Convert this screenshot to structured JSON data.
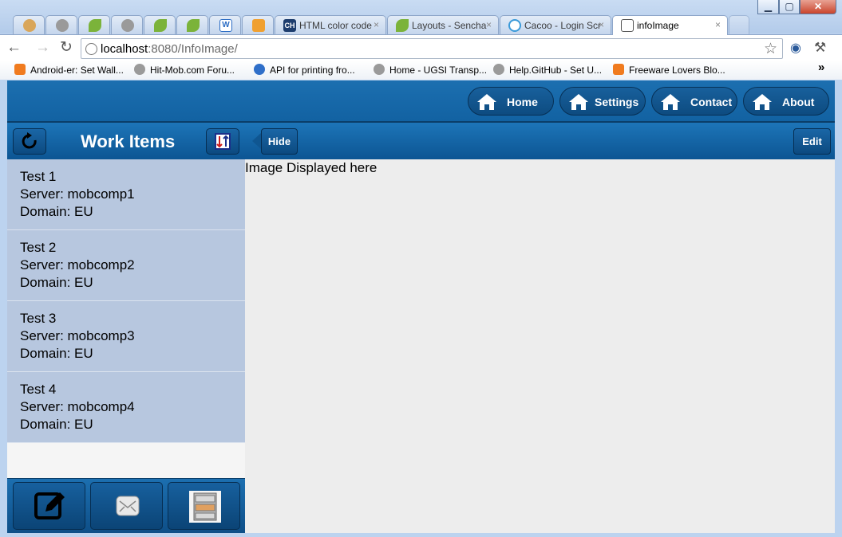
{
  "browser": {
    "tabs": [
      {
        "title": "",
        "icon": "cookie-icon",
        "color": "#d9a65a"
      },
      {
        "title": "",
        "icon": "globe-icon",
        "color": "#8a8a8a"
      },
      {
        "title": "",
        "icon": "sencha-leaf-icon",
        "color": "#7bb33a"
      },
      {
        "title": "",
        "icon": "globe-icon",
        "color": "#8a8a8a"
      },
      {
        "title": "",
        "icon": "sencha-leaf-icon",
        "color": "#7bb33a"
      },
      {
        "title": "",
        "icon": "sencha-leaf-icon",
        "color": "#7bb33a"
      },
      {
        "title": "",
        "icon": "word-doc-icon",
        "color": "#2b6cc4"
      },
      {
        "title": "",
        "icon": "blocks-icon",
        "color": "#f0a030"
      },
      {
        "title": "HTML color code",
        "icon": "ch-icon",
        "color": "#1d3d6e"
      },
      {
        "title": "Layouts - Sencha",
        "icon": "sencha-leaf-icon",
        "color": "#7bb33a"
      },
      {
        "title": "Cacoo - Login Scr",
        "icon": "cacoo-icon",
        "color": "#3a9ad9"
      },
      {
        "title": "infoImage",
        "icon": "image-icon",
        "color": "#b08050"
      }
    ],
    "window_controls": {
      "minimize": "▁",
      "maximize": "▢",
      "close": "✕"
    },
    "tab_close_glyph": "×",
    "address": {
      "host": "localhost",
      "rest": ":8080/InfoImage/"
    },
    "bookmarks": [
      {
        "label": "Android-er: Set Wall...",
        "icon": "blogger-icon",
        "color": "#f07b1f"
      },
      {
        "label": "Hit-Mob.com Foru...",
        "icon": "globe-icon",
        "color": "#8a8a8a"
      },
      {
        "label": "API for printing fro...",
        "icon": "blue-globe-icon",
        "color": "#2f6fc9"
      },
      {
        "label": "Home - UGSI Transp...",
        "icon": "globe-icon",
        "color": "#8a8a8a"
      },
      {
        "label": "Help.GitHub - Set U...",
        "icon": "globe-icon",
        "color": "#8a8a8a"
      },
      {
        "label": "Freeware Lovers Blo...",
        "icon": "blogger-icon",
        "color": "#f07b1f"
      }
    ],
    "bookmarks_overflow": "»"
  },
  "nav": {
    "buttons": [
      {
        "label": "Home",
        "icon": "home-icon"
      },
      {
        "label": "Settings",
        "icon": "home-icon"
      },
      {
        "label": "Contact",
        "icon": "home-icon"
      },
      {
        "label": "About",
        "icon": "home-icon"
      }
    ]
  },
  "workitems": {
    "title": "Work Items",
    "hide_label": "Hide",
    "edit_label": "Edit",
    "items": [
      {
        "name": "Test 1",
        "server": "Server: mobcomp1",
        "domain": "Domain: EU"
      },
      {
        "name": "Test 2",
        "server": "Server: mobcomp2",
        "domain": "Domain: EU"
      },
      {
        "name": "Test 3",
        "server": "Server: mobcomp3",
        "domain": "Domain: EU"
      },
      {
        "name": "Test 4",
        "server": "Server: mobcomp4",
        "domain": "Domain: EU"
      }
    ]
  },
  "content": {
    "text": "Image Displayed here"
  },
  "colors": {
    "brand_blue": "#1468aa",
    "list_bg": "#b7c7df",
    "content_bg": "#ededed"
  }
}
